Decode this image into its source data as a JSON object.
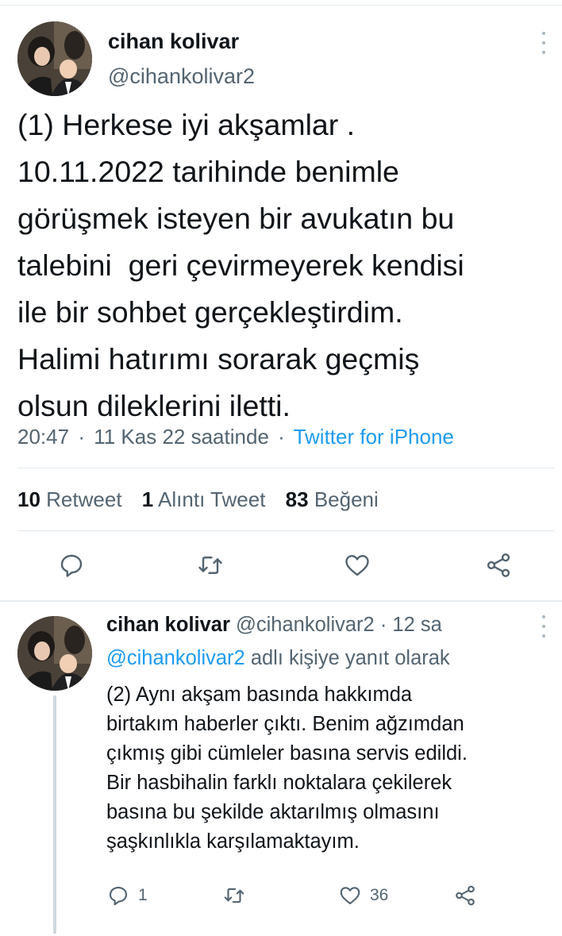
{
  "main_tweet": {
    "author_name": "cihan kolivar",
    "author_handle": "@cihankolivar2",
    "text": "(1) Herkese iyi akşamlar .\n10.11.2022 tarihinde benimle\ngörüşmek isteyen bir avukatın bu\ntalebini  geri çevirmeyerek kendisi\nile bir sohbet gerçekleştirdim.\nHalimi hatırımı sorarak geçmiş\nolsun dileklerini iletti.",
    "time": "20:47",
    "date": "11 Kas 22 saatinde",
    "separator": "·",
    "source": "Twitter for iPhone",
    "stats": {
      "retweets_count": "10",
      "retweets_label": "Retweet",
      "quotes_count": "1",
      "quotes_label": "Alıntı Tweet",
      "likes_count": "83",
      "likes_label": "Beğeni"
    }
  },
  "reply_tweet": {
    "author_name": "cihan kolivar",
    "author_handle": "@cihankolivar2",
    "separator": "·",
    "time_ago": "12 sa",
    "replying_to_handle": "@cihankolivar2",
    "replying_to_suffix": "adlı kişiye yanıt olarak",
    "text": "(2) Aynı akşam basında hakkımda\nbirtakım haberler çıktı. Benim ağzımdan\nçıkmış gibi cümleler basına servis edildi.\nBir hasbihalin farklı noktalara çekilerek\nbasına bu şekilde aktarılmış olmasını\nşaşkınlıkla karşılamaktayım.",
    "reply_count": "1",
    "like_count": "36"
  },
  "icons": [
    "more-vertical-icon",
    "reply-icon",
    "retweet-icon",
    "like-icon",
    "share-icon"
  ],
  "colors": {
    "text": "#0f1419",
    "secondary": "#536471",
    "link": "#1d9bf0",
    "icon": "#536471",
    "divider": "#e1e8ed",
    "thread_line": "#cfd9de"
  }
}
